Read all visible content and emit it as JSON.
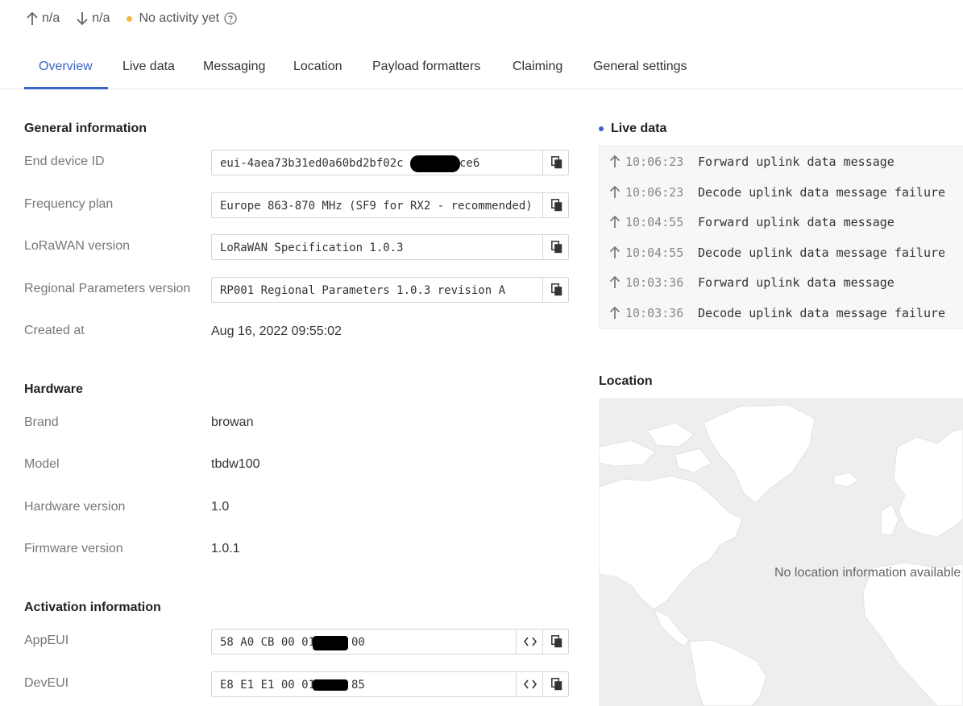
{
  "status": {
    "uplink": "n/a",
    "downlink": "n/a",
    "activity": "No activity yet",
    "activity_color": "#f5b83d"
  },
  "tabs": [
    {
      "label": "Overview",
      "active": true
    },
    {
      "label": "Live data"
    },
    {
      "label": "Messaging"
    },
    {
      "label": "Location"
    },
    {
      "label": "Payload formatters"
    },
    {
      "label": "Claiming"
    },
    {
      "label": "General settings"
    }
  ],
  "general": {
    "heading": "General information",
    "end_device_id": {
      "label": "End device ID",
      "value": "eui-4aea73b31ed0a60bd2bf02c",
      "value_suffix": "ce6"
    },
    "frequency_plan": {
      "label": "Frequency plan",
      "value": "Europe 863-870 MHz (SF9 for RX2 - recommended)"
    },
    "lorawan_version": {
      "label": "LoRaWAN version",
      "value": "LoRaWAN Specification 1.0.3"
    },
    "regional_params": {
      "label": "Regional Parameters version",
      "value": "RP001 Regional Parameters 1.0.3 revision A"
    },
    "created_at": {
      "label": "Created at",
      "value": "Aug 16, 2022 09:55:02"
    }
  },
  "hardware": {
    "heading": "Hardware",
    "brand": {
      "label": "Brand",
      "value": "browan"
    },
    "model": {
      "label": "Model",
      "value": "tbdw100"
    },
    "hardware_version": {
      "label": "Hardware version",
      "value": "1.0"
    },
    "firmware_version": {
      "label": "Firmware version",
      "value": "1.0.1"
    }
  },
  "activation": {
    "heading": "Activation information",
    "app_eui": {
      "label": "AppEUI",
      "value_prefix": "58 A0 CB 00 01",
      "value_suffix": "00"
    },
    "dev_eui": {
      "label": "DevEUI",
      "value_prefix": "E8 E1 E1 00 01",
      "value_suffix": "85"
    }
  },
  "live_data": {
    "heading": "Live data",
    "events": [
      {
        "time": "10:06:23",
        "message": "Forward uplink data message"
      },
      {
        "time": "10:06:23",
        "message": "Decode uplink data message failure"
      },
      {
        "time": "10:04:55",
        "message": "Forward uplink data message"
      },
      {
        "time": "10:04:55",
        "message": "Decode uplink data message failure"
      },
      {
        "time": "10:03:36",
        "message": "Forward uplink data message"
      },
      {
        "time": "10:03:36",
        "message": "Decode uplink data message failure"
      }
    ]
  },
  "location": {
    "heading": "Location",
    "empty_text": "No location information available"
  },
  "colors": {
    "accent": "#3b64c7",
    "map_land": "#ffffff",
    "map_bg": "#eeeeee"
  }
}
